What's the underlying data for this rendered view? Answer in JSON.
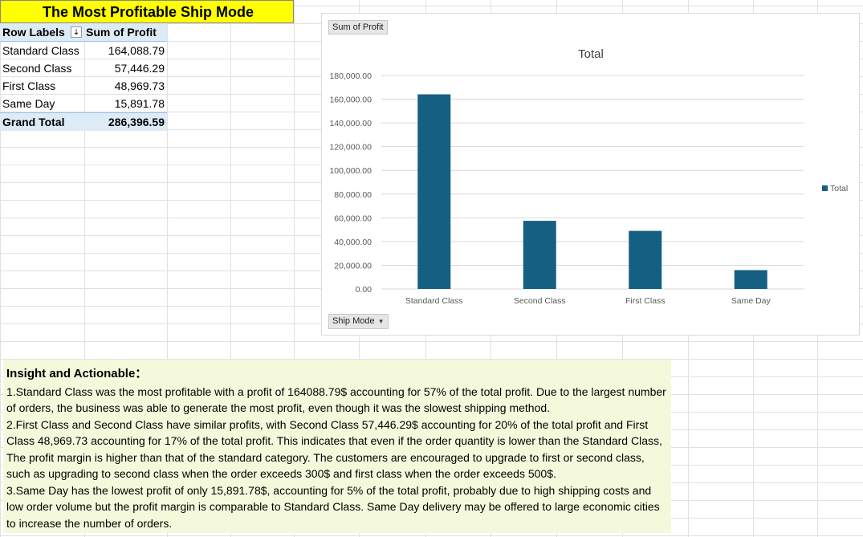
{
  "title": "The Most Profitable Ship Mode",
  "pivot": {
    "header_label": "Row Labels",
    "header_value": "Sum of Profit",
    "filter_glyph": "⇣",
    "rows": [
      {
        "label": "Standard Class",
        "value": "164,088.79"
      },
      {
        "label": "Second Class",
        "value": "57,446.29"
      },
      {
        "label": "First Class",
        "value": "48,969.73"
      },
      {
        "label": "Same Day",
        "value": "15,891.78"
      }
    ],
    "total_label": "Grand Total",
    "total_value": "286,396.59"
  },
  "chart_ui": {
    "value_field_button": "Sum of Profit",
    "axis_field_button": "Ship Mode",
    "dropdown_glyph": "▼"
  },
  "chart_data": {
    "type": "bar",
    "title": "Total",
    "categories": [
      "Standard Class",
      "Second Class",
      "First Class",
      "Same Day"
    ],
    "series": [
      {
        "name": "Total",
        "values": [
          164088.79,
          57446.29,
          48969.73,
          15891.78
        ],
        "color": "#156082"
      }
    ],
    "ylim": [
      0,
      180000
    ],
    "yticks": [
      0,
      20000,
      40000,
      60000,
      80000,
      100000,
      120000,
      140000,
      160000,
      180000
    ],
    "ytick_labels": [
      "0.00",
      "20,000.00",
      "40,000.00",
      "60,000.00",
      "80,000.00",
      "100,000.00",
      "120,000.00",
      "140,000.00",
      "160,000.00",
      "180,000.00"
    ],
    "grid": true,
    "legend": "right"
  },
  "insight": {
    "heading": "Insight and Actionable：",
    "points": [
      "1.Standard Class was the most profitable with a profit of 164088.79$ accounting for 57% of the total profit. Due to the largest number of orders, the business was able to generate the most profit, even though it was the slowest shipping method.",
      "2.First Class and Second Class have similar profits, with Second Class 57,446.29$ accounting for 20% of the total profit and First Class 48,969.73 accounting for 17% of the total profit. This indicates that even if the order quantity is lower than the Standard Class, The profit margin is higher than that of the standard category. The customers are encouraged to upgrade to first or second class, such as upgrading to second class when the order exceeds 300$ and first class when the order exceeds 500$.",
      "3.Same Day has the lowest profit of only 15,891.78$, accounting for 5% of the total profit, probably due to high shipping costs and low order volume but the profit margin is comparable to Standard Class. Same Day delivery may be offered to large economic cities to increase the number of orders."
    ]
  },
  "colors": {
    "title_bg": "#ffff00",
    "pivot_header_bg": "#ddebf7",
    "insight_bg": "#f5f9dc",
    "bar": "#156082"
  }
}
